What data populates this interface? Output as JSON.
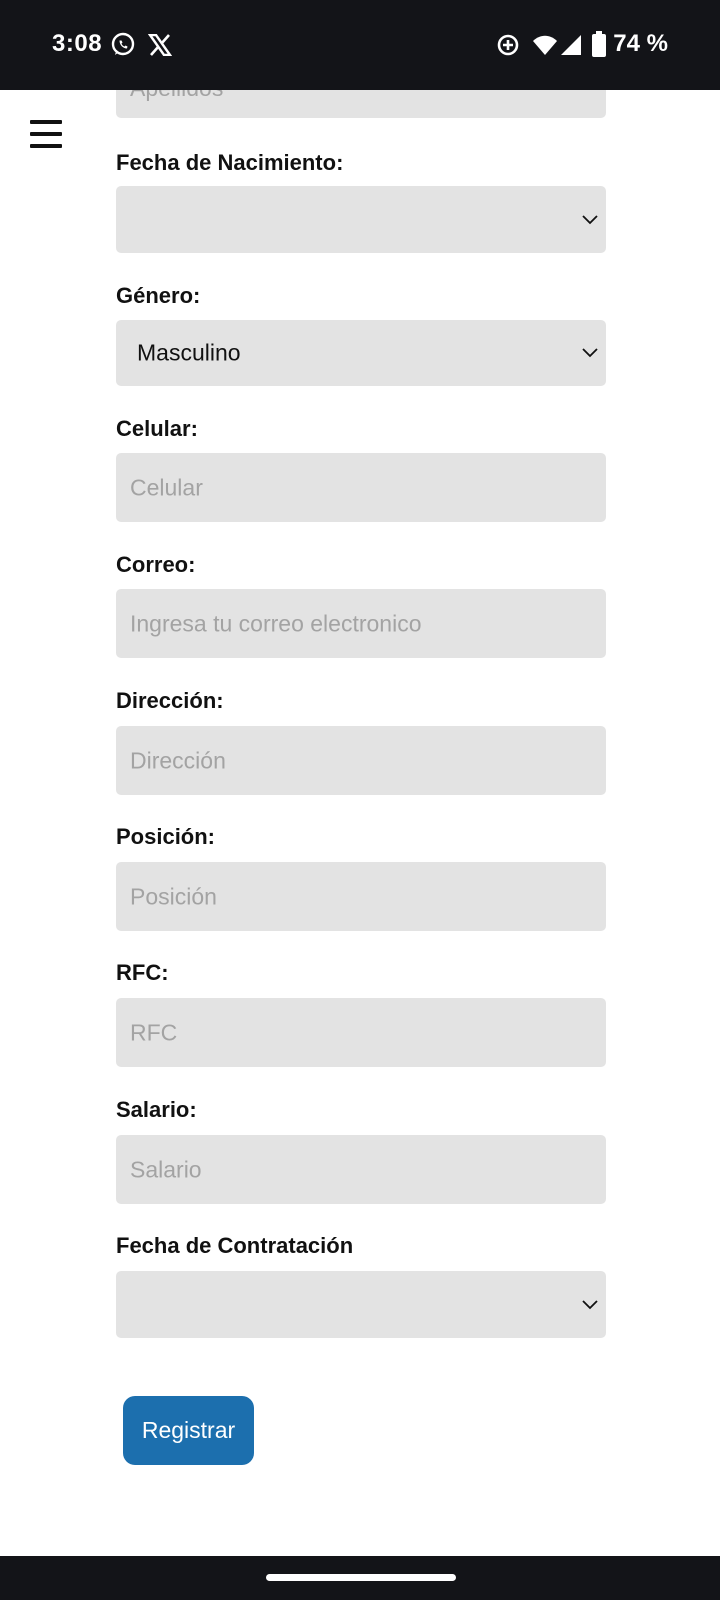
{
  "status_bar": {
    "time": "3:08",
    "battery": "74 %",
    "icons": [
      "whatsapp-icon",
      "x-icon",
      "data-saver-icon",
      "wifi-icon",
      "signal-icon",
      "battery-icon"
    ]
  },
  "menu": {
    "icon": "hamburger-menu-icon"
  },
  "form": {
    "apellidos": {
      "placeholder": "Apellidos"
    },
    "fecha_nacimiento": {
      "label": "Fecha de Nacimiento:",
      "value": ""
    },
    "genero": {
      "label": "Género:",
      "value": "Masculino"
    },
    "celular": {
      "label": "Celular:",
      "placeholder": "Celular"
    },
    "correo": {
      "label": "Correo:",
      "placeholder": "Ingresa tu correo electronico"
    },
    "direccion": {
      "label": "Dirección:",
      "placeholder": "Dirección"
    },
    "posicion": {
      "label": "Posición:",
      "placeholder": "Posición"
    },
    "rfc": {
      "label": "RFC:",
      "placeholder": "RFC"
    },
    "salario": {
      "label": "Salario:",
      "placeholder": "Salario"
    },
    "fecha_contratacion": {
      "label": "Fecha de Contratación",
      "value": ""
    },
    "submit_label": "Registrar"
  },
  "colors": {
    "primary_button": "#1c6fae",
    "field_background": "#e3e3e3",
    "placeholder_text": "#a3a3a3",
    "system_bar": "#131418"
  }
}
